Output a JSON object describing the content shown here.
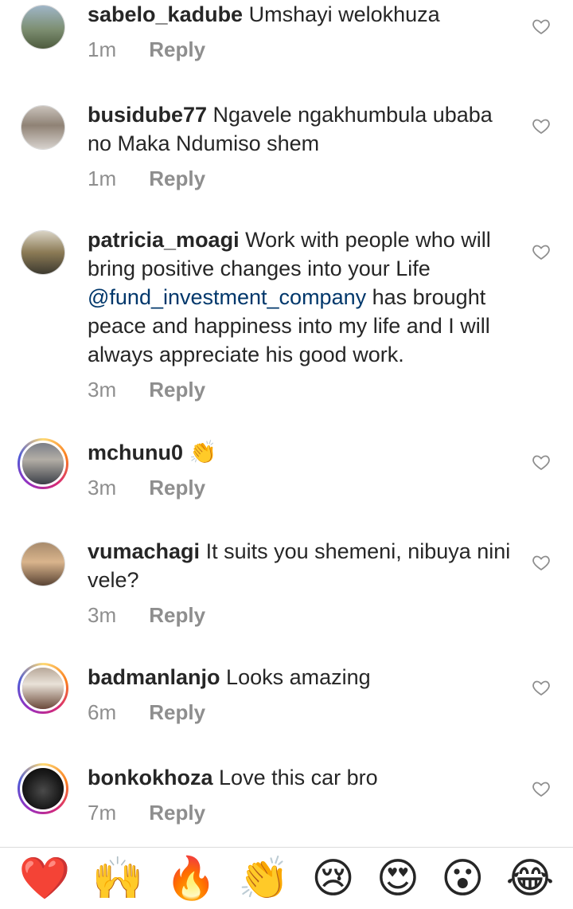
{
  "comments": [
    {
      "username": "sabelo_kadube",
      "text": "Umshayi welokhuza",
      "time": "1m",
      "reply": "Reply"
    },
    {
      "username": "busidube77",
      "text": "Ngavele ngakhumbula ubaba no Maka Ndumiso shem",
      "time": "1m",
      "reply": "Reply"
    },
    {
      "username": "patricia_moagi",
      "text_before": "Work with people who will bring positive changes into your Life ",
      "mention": "@fund_investment_company",
      "text_after": " has brought peace and happiness into my life and I will always appreciate his good work.",
      "time": "3m",
      "reply": "Reply"
    },
    {
      "username": "mchunu0",
      "text": "👏",
      "time": "3m",
      "reply": "Reply"
    },
    {
      "username": "vumachagi",
      "text": "It suits you shemeni, nibuya nini vele?",
      "time": "3m",
      "reply": "Reply"
    },
    {
      "username": "badmanlanjo",
      "text": "Looks amazing",
      "time": "6m",
      "reply": "Reply"
    },
    {
      "username": "bonkokhoza",
      "text": "Love this car bro",
      "time": "7m",
      "reply": "Reply"
    }
  ],
  "quick_reactions": [
    "❤️",
    "🙌",
    "🔥",
    "👏",
    "😢",
    "😍",
    "😮",
    "😂"
  ],
  "colors": {
    "username": "#262626",
    "meta": "#8e8e8e",
    "mention": "#00376b"
  },
  "icons": {
    "like": "heart-outline-icon"
  }
}
